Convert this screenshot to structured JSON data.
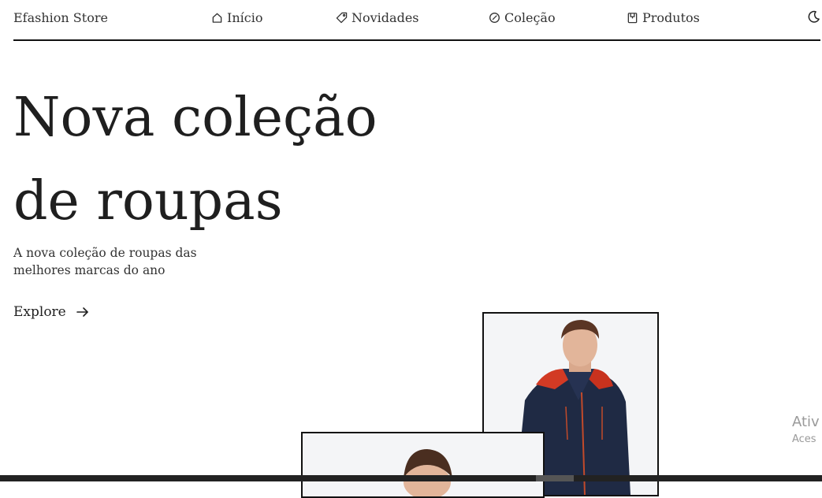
{
  "header": {
    "logo": "Efashion Store",
    "nav": [
      {
        "label": "Início",
        "icon": "home-icon"
      },
      {
        "label": "Novidades",
        "icon": "tag-icon"
      },
      {
        "label": "Coleção",
        "icon": "compass-icon"
      },
      {
        "label": "Produtos",
        "icon": "shirt-icon"
      }
    ],
    "theme_icon": "moon-icon"
  },
  "hero": {
    "title_line1": "Nova coleção",
    "title_line2": "de roupas",
    "description": "A nova coleção de roupas das melhores marcas do ano",
    "cta": "Explore"
  },
  "watermark": {
    "line1": "Ativ",
    "line2": "Aces"
  },
  "colors": {
    "text": "#1f1f1f",
    "border": "#111111",
    "card_bg": "#f4f5f7",
    "jacket": "#1f2a44",
    "jacket_accent": "#d23a24"
  }
}
